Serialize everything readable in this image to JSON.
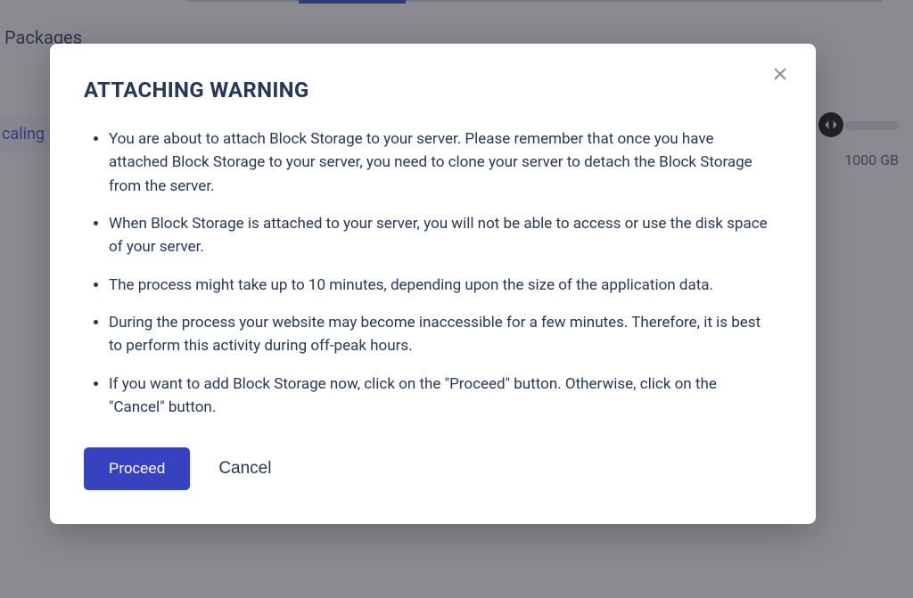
{
  "background": {
    "packages_label": "Packages",
    "sidebar_item": "caling",
    "slider_value": "1000 GB"
  },
  "modal": {
    "title": "ATTACHING WARNING",
    "bullets": [
      "You are about to attach Block Storage to your server. Please remember that once you have attached Block Storage to your server, you need to clone your server to detach the Block Storage from the server.",
      "When Block Storage is attached to your server, you will not be able to access or use the disk space of your server.",
      "The process might take up to 10 minutes, depending upon the size of the application data.",
      "During the process your website may become inaccessible for a few minutes. Therefore, it is best to perform this activity during off-peak hours.",
      "If you want to add Block Storage now, click on the \"Proceed\" button. Otherwise, click on the \"Cancel\" button."
    ],
    "proceed_label": "Proceed",
    "cancel_label": "Cancel"
  }
}
